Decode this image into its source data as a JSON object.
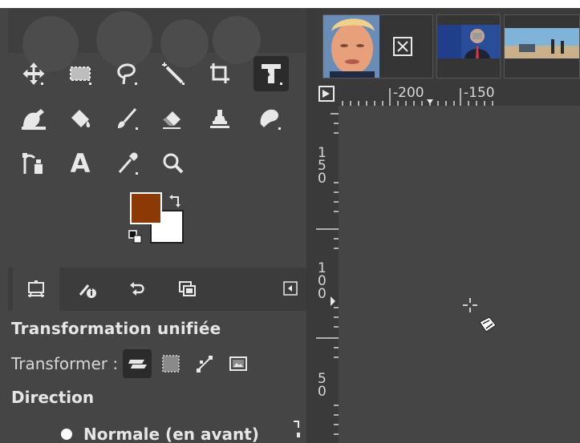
{
  "toolbox": {
    "tools": [
      {
        "name": "move-tool-icon"
      },
      {
        "name": "rect-select-icon"
      },
      {
        "name": "free-select-icon"
      },
      {
        "name": "fuzzy-select-icon"
      },
      {
        "name": "crop-icon"
      },
      {
        "name": "unified-transform-icon",
        "active": true
      },
      {
        "name": "warp-transform-icon"
      },
      {
        "name": "bucket-fill-icon"
      },
      {
        "name": "paintbrush-icon"
      },
      {
        "name": "eraser-icon"
      },
      {
        "name": "clone-icon"
      },
      {
        "name": "smudge-icon"
      },
      {
        "name": "paths-icon"
      },
      {
        "name": "text-icon",
        "glyph": "A"
      },
      {
        "name": "color-picker-icon"
      },
      {
        "name": "zoom-icon"
      }
    ],
    "fg_color": "#8b3a05",
    "bg_color": "#ffffff"
  },
  "dock_tabs": [
    {
      "name": "tool-options-tab",
      "selected": true
    },
    {
      "name": "device-status-tab"
    },
    {
      "name": "undo-history-tab"
    },
    {
      "name": "images-tab"
    }
  ],
  "tool_options": {
    "title": "Transformation unifiée",
    "transform_label": "Transformer :",
    "direction_label": "Direction",
    "radio_label": "Normale (en avant)"
  },
  "ruler": {
    "top_labels": [
      "-200",
      "-150"
    ],
    "left_labels": [
      "1",
      "5",
      "0",
      "1",
      "0",
      "0",
      "5",
      "0"
    ]
  }
}
